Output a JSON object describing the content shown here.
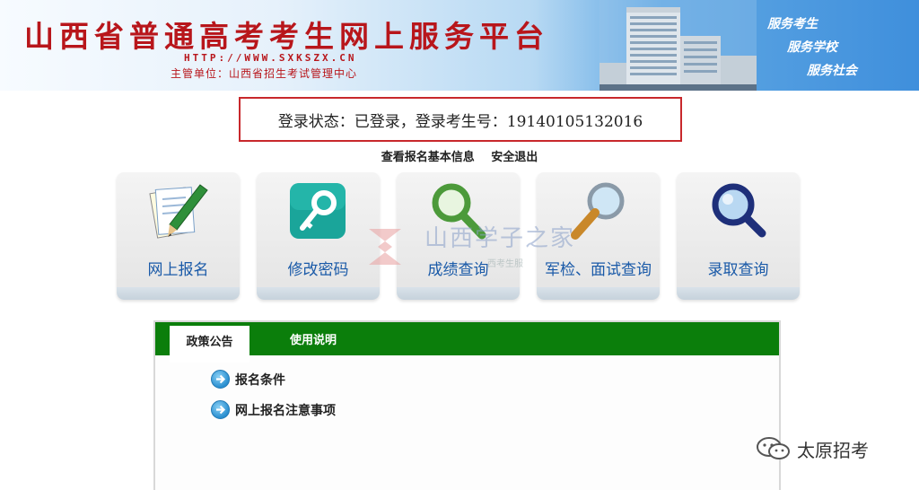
{
  "banner": {
    "title": "山西省普通高考考生网上服务平台",
    "url": "HTTP://WWW.SXKSZX.CN",
    "org": "主管单位：山西省招生考试管理中心",
    "slogans": [
      "服务考生",
      "服务学校",
      "服务社会"
    ]
  },
  "status": {
    "text": "登录状态：已登录，登录考生号：19140105132016"
  },
  "links": {
    "view_info": "查看报名基本信息",
    "logout": "安全退出"
  },
  "tiles": [
    {
      "label": "网上报名",
      "icon": "pencil-paper-icon"
    },
    {
      "label": "修改密码",
      "icon": "key-icon"
    },
    {
      "label": "成绩查询",
      "icon": "magnifier-green-icon"
    },
    {
      "label": "军检、面试查询",
      "icon": "magnifier-gold-icon"
    },
    {
      "label": "录取查询",
      "icon": "magnifier-blue-icon"
    }
  ],
  "watermark": {
    "text": "山西学子之家",
    "sub": "西考生服"
  },
  "notice_panel": {
    "tabs": [
      "政策公告",
      "使用说明"
    ],
    "items": [
      "报名条件",
      "网上报名注意事项"
    ]
  },
  "wechat": {
    "name": "太原招考"
  },
  "colors": {
    "brand_red": "#b8161b",
    "tab_green": "#0b7e0b",
    "tile_label_blue": "#1a5aa8"
  }
}
